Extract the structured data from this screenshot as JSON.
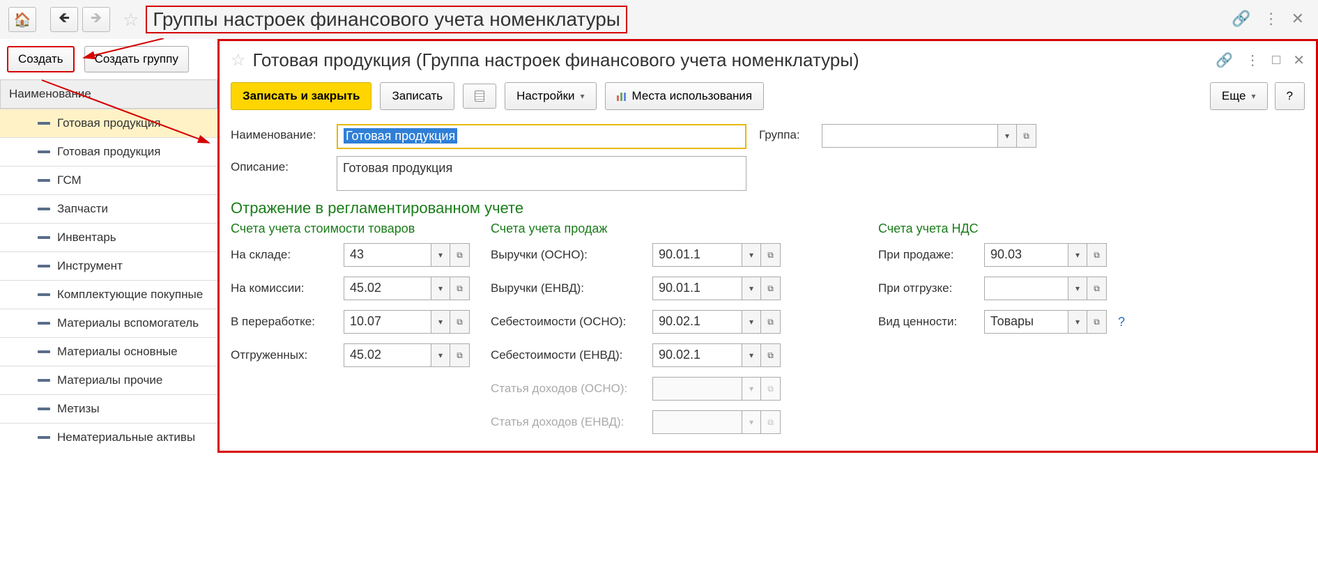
{
  "page": {
    "title": "Группы настроек финансового учета номенклатуры"
  },
  "toolbar_left": {
    "create": "Создать",
    "create_group": "Создать группу"
  },
  "table": {
    "header": "Наименование",
    "rows": [
      {
        "label": "Готовая продукция",
        "selected": true
      },
      {
        "label": "Готовая продукция"
      },
      {
        "label": "ГСМ"
      },
      {
        "label": "Запчасти"
      },
      {
        "label": "Инвентарь"
      },
      {
        "label": "Инструмент"
      },
      {
        "label": "Комплектующие покупные"
      },
      {
        "label": "Материалы вспомогатель"
      },
      {
        "label": "Материалы основные"
      },
      {
        "label": "Материалы прочие"
      },
      {
        "label": "Метизы"
      },
      {
        "label": "Нематериальные активы"
      }
    ]
  },
  "panel": {
    "title": "Готовая продукция (Группа настроек финансового учета номенклатуры)",
    "toolbar": {
      "save_close": "Записать и закрыть",
      "save": "Записать",
      "settings": "Настройки",
      "usage_places": "Места использования",
      "more": "Еще",
      "help": "?"
    },
    "fields": {
      "name_label": "Наименование:",
      "name_value": "Готовая продукция",
      "desc_label": "Описание:",
      "desc_value": "Готовая продукция",
      "group_label": "Группа:",
      "group_value": ""
    },
    "section": {
      "title": "Отражение в регламентированном учете",
      "col1": {
        "title": "Счета учета стоимости товаров",
        "rows": [
          {
            "label": "На складе:",
            "value": "43"
          },
          {
            "label": "На комиссии:",
            "value": "45.02"
          },
          {
            "label": "В переработке:",
            "value": "10.07"
          },
          {
            "label": "Отгруженных:",
            "value": "45.02"
          }
        ]
      },
      "col2": {
        "title": "Счета учета продаж",
        "rows": [
          {
            "label": "Выручки (ОСНО):",
            "value": "90.01.1"
          },
          {
            "label": "Выручки (ЕНВД):",
            "value": "90.01.1"
          },
          {
            "label": "Себестоимости (ОСНО):",
            "value": "90.02.1"
          },
          {
            "label": "Себестоимости (ЕНВД):",
            "value": "90.02.1"
          },
          {
            "label": "Статья доходов (ОСНО):",
            "value": "",
            "disabled": true
          },
          {
            "label": "Статья доходов (ЕНВД):",
            "value": "",
            "disabled": true
          }
        ]
      },
      "col3": {
        "title": "Счета учета НДС",
        "rows": [
          {
            "label": "При продаже:",
            "value": "90.03"
          },
          {
            "label": "При отгрузке:",
            "value": ""
          },
          {
            "label": "Вид ценности:",
            "value": "Товары",
            "help": true
          }
        ]
      }
    }
  }
}
